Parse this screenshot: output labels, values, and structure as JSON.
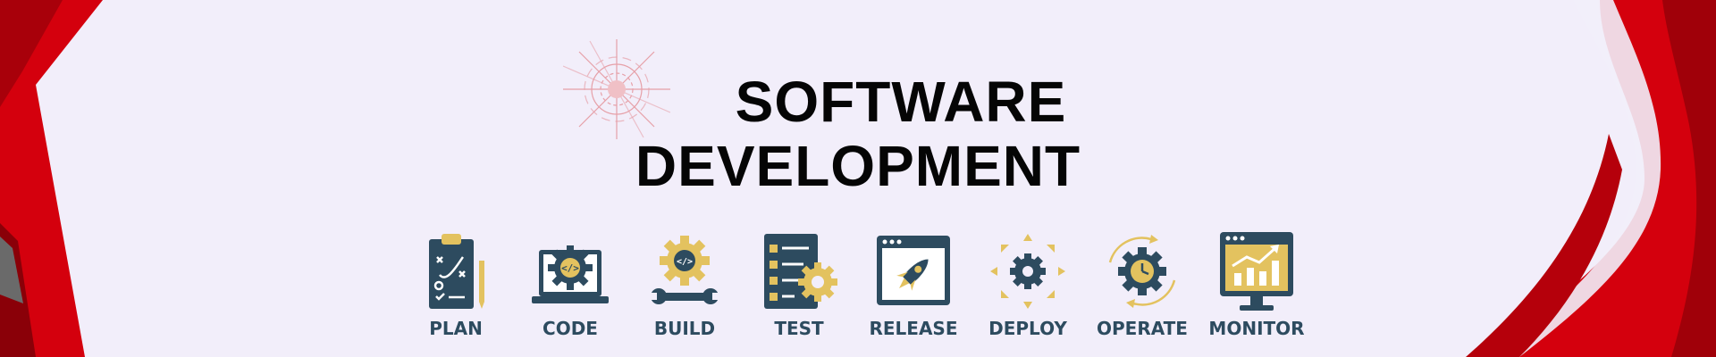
{
  "title": {
    "line1": "SOFTWARE",
    "line2": "DEVELOPMENT"
  },
  "colors": {
    "navy": "#2d4b5f",
    "gold": "#e3c25f",
    "red": "#d4000d",
    "background": "#f2eefa"
  },
  "steps": [
    {
      "label": "PLAN",
      "icon": "clipboard-plan-icon"
    },
    {
      "label": "CODE",
      "icon": "laptop-code-gear-icon"
    },
    {
      "label": "BUILD",
      "icon": "gear-wrench-icon"
    },
    {
      "label": "TEST",
      "icon": "checklist-gear-icon"
    },
    {
      "label": "RELEASE",
      "icon": "browser-rocket-icon"
    },
    {
      "label": "DEPLOY",
      "icon": "gear-arrows-icon"
    },
    {
      "label": "OPERATE",
      "icon": "gear-clock-cycle-icon"
    },
    {
      "label": "MONITOR",
      "icon": "monitor-chart-icon"
    }
  ]
}
